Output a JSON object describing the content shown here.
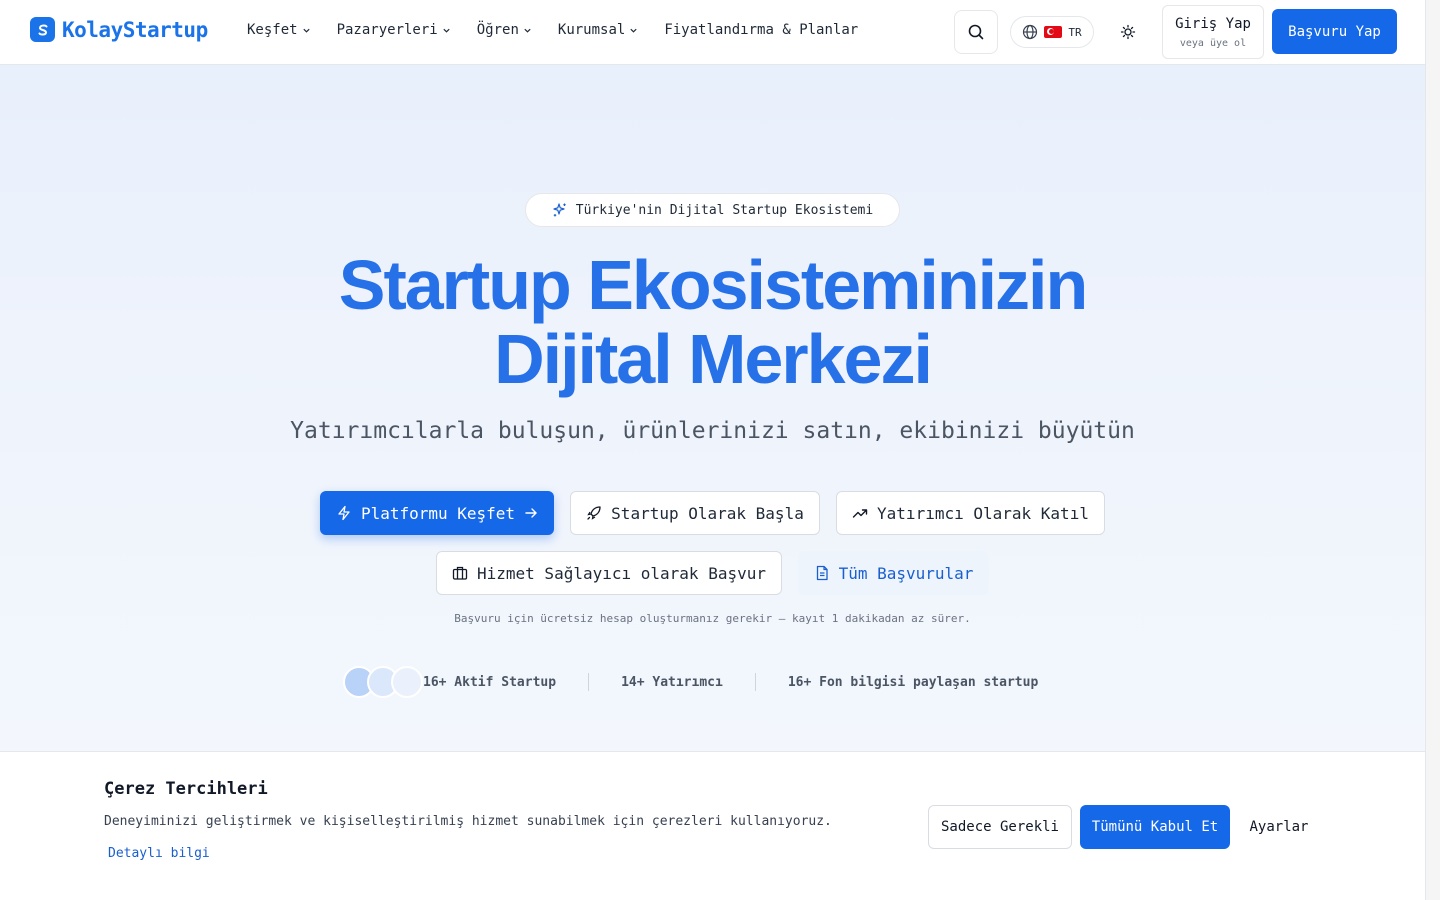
{
  "brand": {
    "name": "KolayStartup",
    "logo_glyph": "S",
    "color": "#1a73e8"
  },
  "nav": {
    "items": [
      {
        "label": "Keşfet",
        "dropdown": true
      },
      {
        "label": "Pazaryerleri",
        "dropdown": true
      },
      {
        "label": "Öğren",
        "dropdown": true
      },
      {
        "label": "Kurumsal",
        "dropdown": true
      },
      {
        "label": "Fiyatlandırma & Planlar",
        "dropdown": false
      }
    ],
    "language": "TR",
    "login_label": "Giriş Yap",
    "login_sub": "veya üye ol",
    "apply_label": "Başvuru Yap"
  },
  "hero": {
    "badge": "Türkiye'nin Dijital Startup Ekosistemi",
    "title_line1": "Startup Ekosisteminizin",
    "title_line2": "Dijital Merkezi",
    "subtitle": "Yatırımcılarla buluşun, ürünlerinizi satın, ekibinizi büyütün",
    "buttons": {
      "explore": "Platformu Keşfet",
      "startup": "Startup Olarak Başla",
      "investor": "Yatırımcı Olarak Katıl",
      "provider": "Hizmet Sağlayıcı olarak Başvur",
      "all": "Tüm Başvurular"
    },
    "note": "Başvuru için ücretsiz hesap oluşturmanız gerekir — kayıt 1 dakikadan az sürer.",
    "stats": [
      "16+ Aktif Startup",
      "14+ Yatırımcı",
      "16+ Fon bilgisi paylaşan startup"
    ]
  },
  "cookie": {
    "title": "Çerez Tercihleri",
    "text": "Deneyiminizi geliştirmek ve kişiselleştirilmiş hizmet sunabilmek için çerezleri kullanıyoruz.",
    "link": "Detaylı bilgi",
    "necessary": "Sadece Gerekli",
    "accept_all": "Tümünü Kabul Et",
    "settings": "Ayarlar"
  },
  "colors": {
    "primary": "#1568e8",
    "title": "#2670e8",
    "text": "#1f2937"
  }
}
